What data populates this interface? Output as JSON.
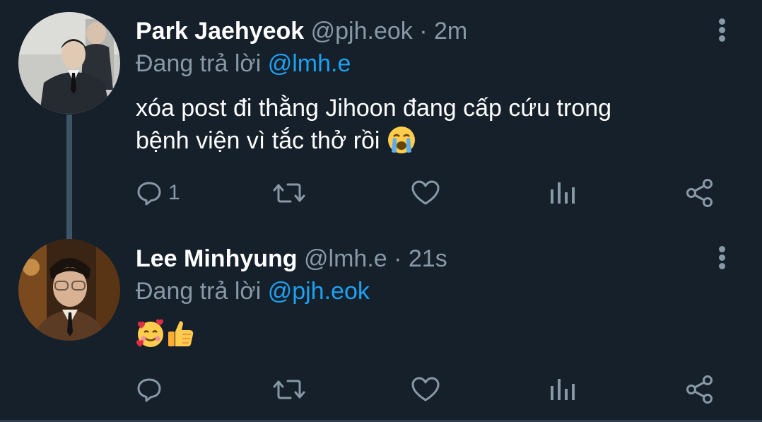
{
  "tweets": [
    {
      "display_name": "Park Jaehyeok",
      "handle": "@pjh.eok",
      "separator": " · ",
      "time": "2m",
      "reply_prefix": "Đang trả lời ",
      "reply_to": "@lmh.e",
      "text_line1": "xóa post đi thằng Jihoon đang cấp cứu trong",
      "text_line2": "bệnh viện vì tắc thở rồi",
      "emojis": [
        "loudly-crying-face"
      ],
      "reply_count": "1"
    },
    {
      "display_name": "Lee Minhyung",
      "handle": "@lmh.e",
      "separator": " · ",
      "time": "21s",
      "reply_prefix": "Đang trả lời ",
      "reply_to": "@pjh.eok",
      "emojis": [
        "smiling-face-with-hearts",
        "thumbs-up"
      ]
    }
  ],
  "colors": {
    "background": "#15202b",
    "text": "#ffffff",
    "secondary": "#8899a6",
    "link": "#1da1f2",
    "thread_line": "#3d5466"
  },
  "icons": [
    "reply-icon",
    "retweet-icon",
    "like-icon",
    "analytics-icon",
    "share-icon",
    "more-options-icon"
  ]
}
